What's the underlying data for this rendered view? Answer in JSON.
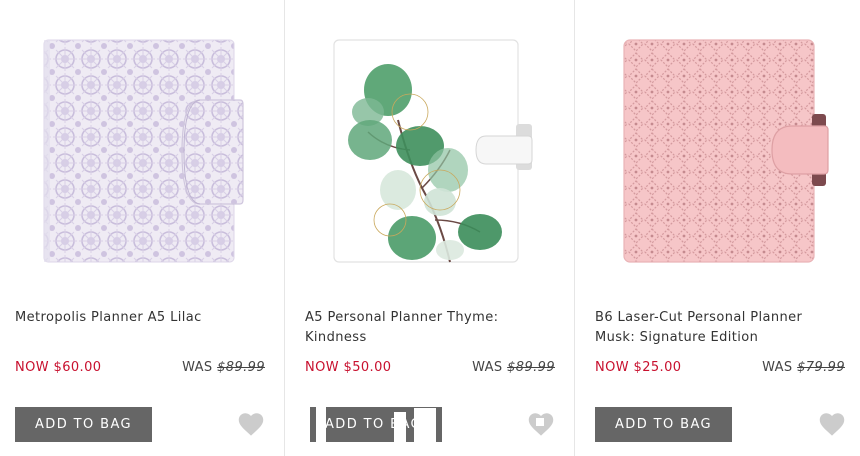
{
  "products": [
    {
      "title": "Metropolis Planner A5 Lilac",
      "now_price": "NOW $60.00",
      "was_label": "WAS",
      "was_price": "$89.99",
      "button_label": "ADD TO BAG",
      "image_icon": "lilac-planner-image"
    },
    {
      "title": "A5 Personal Planner Thyme: Kindness",
      "now_price": "NOW $50.00",
      "was_label": "WAS",
      "was_price": "$89.99",
      "button_label": "ADD TO BAG",
      "image_icon": "eucalyptus-planner-image"
    },
    {
      "title": "B6 Laser-Cut Personal Planner Musk: Signature Edition",
      "now_price": "NOW $25.00",
      "was_label": "WAS",
      "was_price": "$79.99",
      "button_label": "ADD TO BAG",
      "image_icon": "pink-laser-cut-planner-image"
    }
  ],
  "colors": {
    "sale": "#c8102e",
    "button": "#666666",
    "heart": "#cccccc"
  },
  "icons": {
    "wishlist": "heart-icon"
  }
}
